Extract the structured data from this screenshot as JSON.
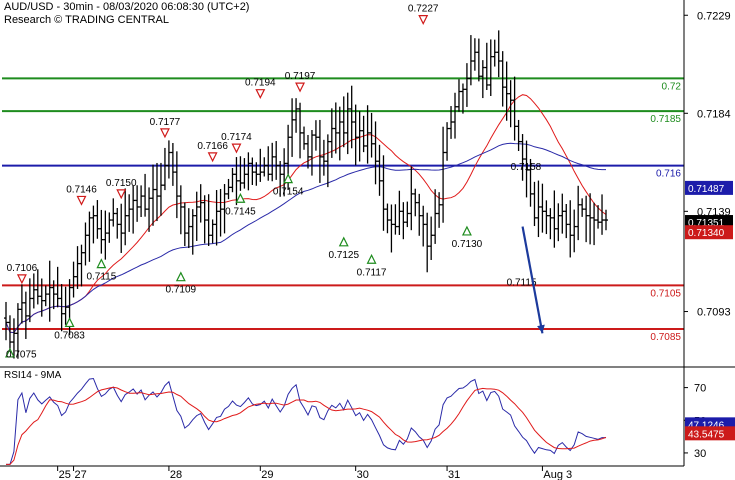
{
  "header": {
    "title": "AUD/USD - 30min - 08/03/2020 06:08:30 (UTC+2)",
    "source": "Research © TRADING CENTRAL"
  },
  "colors": {
    "price": "#000000",
    "ma_fast": "#e01a1a",
    "ma_slow": "#2a2aa8",
    "green_line": "#1e8c1e",
    "blue_line": "#1c1caa",
    "red_line": "#cc1a1a",
    "arrow": "#1c3a9c",
    "up_marker": "#1e8c1e",
    "down_marker": "#d01a1a"
  },
  "chart_data": [
    {
      "type": "line",
      "name": "price-panel",
      "ylim": [
        0.7068,
        0.7236
      ],
      "x_range": [
        0,
        150
      ],
      "y_ticks": [
        "0.7229",
        "0.7184",
        "0.7139",
        "0.7093"
      ],
      "x_ticks": [
        {
          "x": 13,
          "label": "25"
        },
        {
          "x": 17,
          "label": "27"
        },
        {
          "x": 41,
          "label": "28"
        },
        {
          "x": 64,
          "label": "29"
        },
        {
          "x": 88,
          "label": "30"
        },
        {
          "x": 111,
          "label": "31"
        },
        {
          "x": 135,
          "label": "Aug 3"
        }
      ],
      "close": [
        0.7088,
        0.7079,
        0.7083,
        0.7094,
        0.7097,
        0.7091,
        0.7099,
        0.7103,
        0.71,
        0.7098,
        0.7101,
        0.7104,
        0.7101,
        0.7099,
        0.7092,
        0.7095,
        0.7104,
        0.7109,
        0.7115,
        0.712,
        0.7128,
        0.7136,
        0.7137,
        0.7131,
        0.7126,
        0.7129,
        0.7135,
        0.7138,
        0.7133,
        0.7129,
        0.7137,
        0.714,
        0.7144,
        0.7141,
        0.7146,
        0.714,
        0.7145,
        0.7149,
        0.7146,
        0.7151,
        0.716,
        0.7166,
        0.7157,
        0.7146,
        0.7141,
        0.7129,
        0.7132,
        0.7137,
        0.7141,
        0.7143,
        0.7135,
        0.7128,
        0.7133,
        0.7139,
        0.714,
        0.7147,
        0.715,
        0.7156,
        0.7153,
        0.7152,
        0.7156,
        0.7161,
        0.7157,
        0.7156,
        0.7157,
        0.716,
        0.7156,
        0.7164,
        0.716,
        0.7156,
        0.7161,
        0.7173,
        0.7181,
        0.7186,
        0.7175,
        0.717,
        0.7164,
        0.7174,
        0.7173,
        0.7164,
        0.7162,
        0.7171,
        0.7177,
        0.7175,
        0.718,
        0.7175,
        0.7186,
        0.718,
        0.7173,
        0.7176,
        0.7169,
        0.7175,
        0.717,
        0.7162,
        0.7153,
        0.714,
        0.7135,
        0.7133,
        0.7132,
        0.7139,
        0.7134,
        0.7138,
        0.7147,
        0.7143,
        0.7137,
        0.7133,
        0.7123,
        0.7128,
        0.7138,
        0.7142,
        0.7166,
        0.7177,
        0.718,
        0.7187,
        0.7194,
        0.7195,
        0.72,
        0.7208,
        0.7212,
        0.7201,
        0.7205,
        0.7197,
        0.721,
        0.7212,
        0.7208,
        0.7196,
        0.7193,
        0.719,
        0.7178,
        0.7171,
        0.7163,
        0.7158,
        0.7147,
        0.7136,
        0.7141,
        0.7139,
        0.7137,
        0.7136,
        0.7131,
        0.7137,
        0.7139,
        0.7133,
        0.7128,
        0.7132,
        0.7142,
        0.714,
        0.7137,
        0.7136,
        0.7135,
        0.7134,
        0.7135,
        0.7135
      ],
      "moving_averages": [
        {
          "name": "",
          "period": 21,
          "role": "fast"
        },
        {
          "name": "",
          "period": 55,
          "role": "slow"
        }
      ],
      "horizontal_levels": [
        {
          "value": 0.72,
          "label": "0.72",
          "color": "#1e8c1e"
        },
        {
          "value": 0.7185,
          "label": "0.7185",
          "color": "#1e8c1e"
        },
        {
          "value": 0.716,
          "label": "0.716",
          "color": "#1c1caa"
        },
        {
          "value": 0.7105,
          "label": "0.7105",
          "color": "#cc1a1a"
        },
        {
          "value": 0.7085,
          "label": "0.7085",
          "color": "#cc1a1a"
        }
      ],
      "price_tags": [
        {
          "value": 0.7147,
          "label": "0.71487",
          "bg": "#1c1caa"
        },
        {
          "value": 0.7135,
          "label": "0.71351",
          "bg": "#000000"
        },
        {
          "value": 0.7134,
          "label": "0.71340",
          "bg": "#cc1a1a"
        }
      ],
      "markers": [
        {
          "x": 1,
          "value": 0.7074,
          "kind": "up",
          "label": ""
        },
        {
          "x": 4,
          "value": 0.7108,
          "kind": "down",
          "label": "0.7106"
        },
        {
          "x": 16,
          "value": 0.7088,
          "kind": "up",
          "label": "0.7083"
        },
        {
          "x": 19,
          "value": 0.7144,
          "kind": "down",
          "label": "0.7146"
        },
        {
          "x": 24,
          "value": 0.7115,
          "kind": "up",
          "label": "0.7115"
        },
        {
          "x": 29,
          "value": 0.7147,
          "kind": "down",
          "label": "0.7150"
        },
        {
          "x": 40,
          "value": 0.7175,
          "kind": "down",
          "label": "0.7177"
        },
        {
          "x": 44,
          "value": 0.7109,
          "kind": "up",
          "label": "0.7109"
        },
        {
          "x": 52,
          "value": 0.7164,
          "kind": "down",
          "label": "0.7166"
        },
        {
          "x": 58,
          "value": 0.7168,
          "kind": "down",
          "label": "0.7174"
        },
        {
          "x": 59,
          "value": 0.7145,
          "kind": "up",
          "label": "0.7145"
        },
        {
          "x": 64,
          "value": 0.7193,
          "kind": "down",
          "label": "0.7194"
        },
        {
          "x": 71,
          "value": 0.7154,
          "kind": "up",
          "label": "0.7154"
        },
        {
          "x": 74,
          "value": 0.7196,
          "kind": "down",
          "label": "0.7197"
        },
        {
          "x": 85,
          "value": 0.7125,
          "kind": "up",
          "label": "0.7125"
        },
        {
          "x": 92,
          "value": 0.7117,
          "kind": "up",
          "label": "0.7117"
        },
        {
          "x": 105,
          "value": 0.7227,
          "kind": "down",
          "label": "0.7227"
        },
        {
          "x": 116,
          "value": 0.713,
          "kind": "up",
          "label": "0.7130"
        }
      ],
      "level_labels": [
        {
          "x": 0,
          "value": 0.7072,
          "label": "0.7075"
        },
        {
          "x": 127,
          "value": 0.7158,
          "label": "0.7158"
        },
        {
          "x": 126,
          "value": 0.7105,
          "label": "0.7115"
        }
      ],
      "forecast_arrow": {
        "from": {
          "x": 130,
          "value": 0.7132
        },
        "to": {
          "x": 135,
          "value": 0.7083
        }
      }
    },
    {
      "type": "line",
      "name": "indicator-panel",
      "title": "RSI14 - 9MA",
      "ylim": [
        22,
        82
      ],
      "y_ticks": [
        "70",
        "50",
        "30"
      ],
      "rsi_period": 14,
      "signal_period": 9,
      "tags": [
        {
          "value": 47.5,
          "label": "47.1246",
          "bg": "#1c1caa"
        },
        {
          "value": 42.0,
          "label": "43.5475",
          "bg": "#cc1a1a"
        }
      ]
    }
  ]
}
